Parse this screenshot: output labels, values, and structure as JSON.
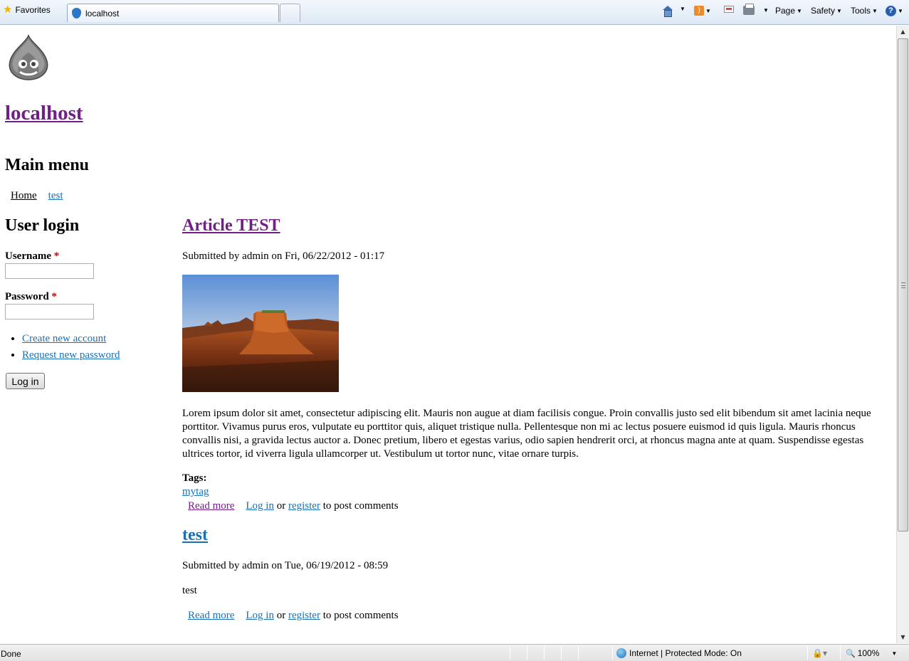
{
  "browser": {
    "favorites_label": "Favorites",
    "tab_title": "localhost",
    "commands": {
      "page": "Page",
      "safety": "Safety",
      "tools": "Tools"
    },
    "status_text": "Done",
    "zone_text": "Internet | Protected Mode: On",
    "zoom": "100%"
  },
  "site": {
    "name": "localhost"
  },
  "main_menu": {
    "title": "Main menu",
    "items": [
      "Home",
      "test"
    ]
  },
  "login": {
    "title": "User login",
    "username_label": "Username",
    "password_label": "Password",
    "required_marker": "*",
    "username_value": "",
    "password_value": "",
    "links": [
      "Create new account",
      "Request new password"
    ],
    "submit_label": "Log in"
  },
  "nodes": [
    {
      "title": "Article TEST",
      "submitted": "Submitted by admin on Fri, 06/22/2012 - 01:17",
      "body": "Lorem ipsum dolor sit amet, consectetur adipiscing elit. Mauris non augue at diam facilisis congue. Proin convallis justo sed elit bibendum sit amet lacinia neque porttitor. Vivamus purus eros, vulputate eu porttitor quis, aliquet tristique nulla. Pellentesque non mi ac lectus posuere euismod id quis ligula. Mauris rhoncus convallis nisi, a gravida lectus auctor a. Donec pretium, libero et egestas varius, odio sapien hendrerit orci, at rhoncus magna ante at quam. Suspendisse egestas ultrices tortor, id viverra ligula ullamcorper ut. Vestibulum ut tortor nunc, vitae ornare turpis.",
      "tags_label": "Tags:",
      "tags": [
        "mytag"
      ],
      "read_more": "Read more",
      "login_link": "Log in",
      "or_text": " or ",
      "register_link": "register",
      "comment_suffix": " to post comments"
    },
    {
      "title": "test",
      "submitted": "Submitted by admin on Tue, 06/19/2012 - 08:59",
      "body": "test",
      "read_more": "Read more",
      "login_link": "Log in",
      "or_text": " or ",
      "register_link": "register",
      "comment_suffix": " to post comments"
    }
  ]
}
